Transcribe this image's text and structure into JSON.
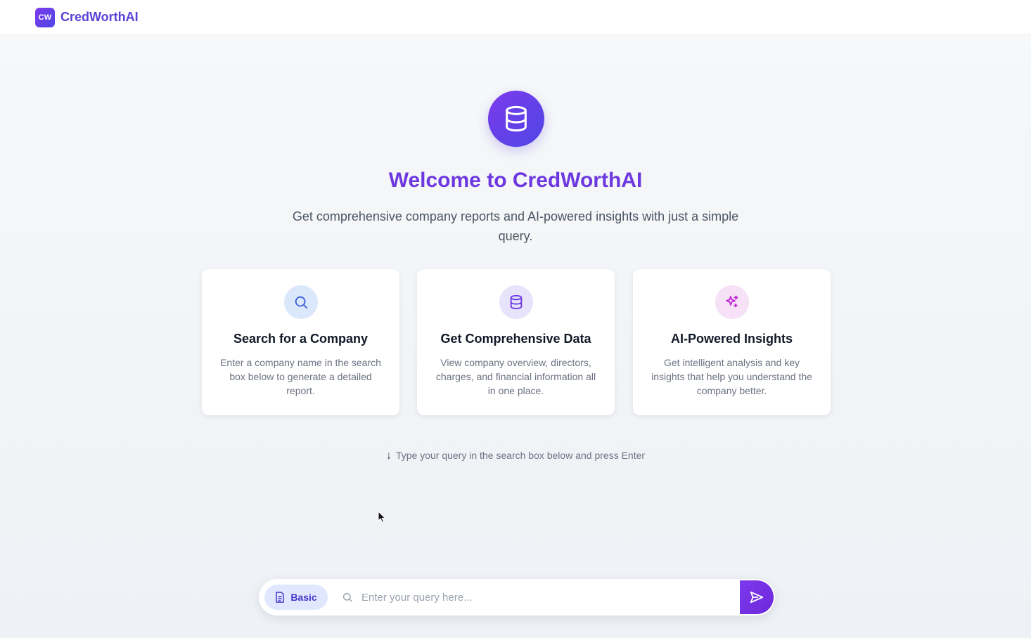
{
  "header": {
    "logo_text": "CW",
    "brand_name": "CredWorthAI"
  },
  "hero": {
    "icon": "database-icon",
    "title": "Welcome to CredWorthAI",
    "subtitle": "Get comprehensive company reports and AI-powered insights with just a simple query."
  },
  "cards": [
    {
      "icon": "search-icon",
      "title": "Search for a Company",
      "description": "Enter a company name in the search box below to generate a detailed report."
    },
    {
      "icon": "database-icon",
      "title": "Get Comprehensive Data",
      "description": "View company overview, directors, charges, and financial information all in one place."
    },
    {
      "icon": "sparkles-icon",
      "title": "AI-Powered Insights",
      "description": "Get intelligent analysis and key insights that help you understand the company better."
    }
  ],
  "hint": {
    "arrow": "↓",
    "text": "Type your query in the search box below and press Enter"
  },
  "search": {
    "mode_label": "Basic",
    "placeholder": "Enter your query here...",
    "value": ""
  },
  "colors": {
    "accent": "#6d38e0",
    "accent_dark": "#4f46e5",
    "mode_bg": "#e0e7ff"
  }
}
